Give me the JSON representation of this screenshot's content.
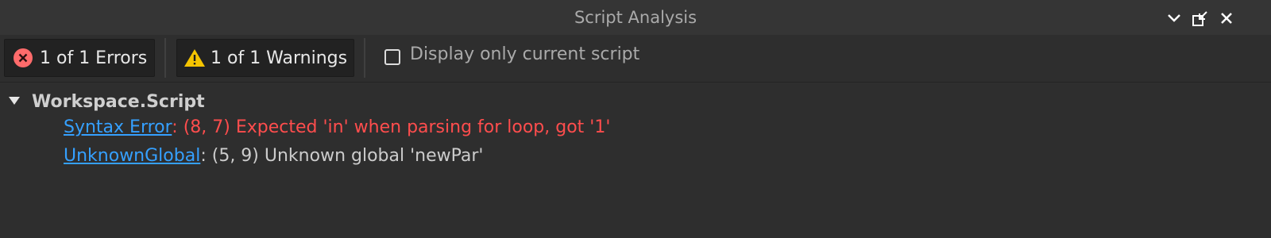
{
  "window": {
    "title": "Script Analysis",
    "controls": {
      "collapse": "chevron-down-icon",
      "undock": "undock-icon",
      "close": "close-icon"
    }
  },
  "toolbar": {
    "errors_label": "1 of 1 Errors",
    "warnings_label": "1 of 1 Warnings",
    "current_script_label": "Display only current script",
    "current_script_checked": false
  },
  "tree": {
    "node_title": "Workspace.Script",
    "issues": [
      {
        "type": "Syntax Error",
        "separator": ":",
        "location": "(8, 7)",
        "message": "Expected 'in' when parsing for loop, got '1'",
        "severity": "error"
      },
      {
        "type": "UnknownGlobal",
        "separator": ":",
        "location": "(5, 9)",
        "message": "Unknown global 'newPar'",
        "severity": "warning"
      }
    ]
  },
  "colors": {
    "error": "#ff4d4d",
    "link": "#35a0ff",
    "warning_icon": "#f5c400",
    "error_icon": "#ff6b6b"
  }
}
